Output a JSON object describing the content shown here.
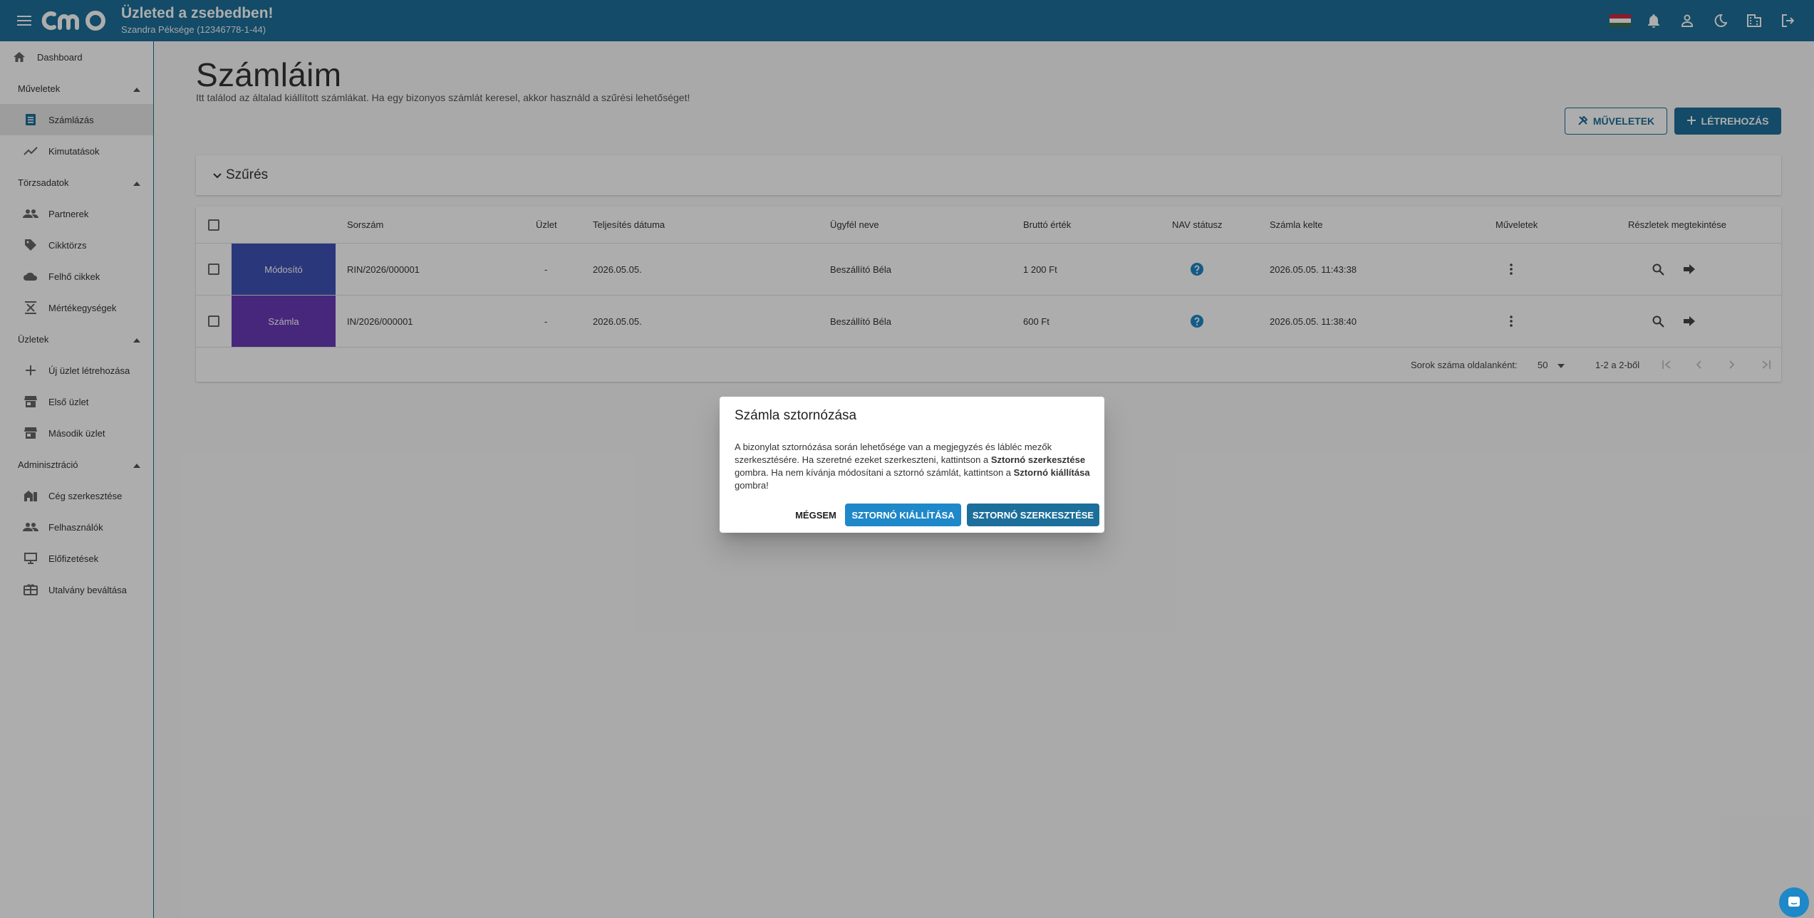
{
  "header": {
    "logo": "cmo",
    "title": "Üzleted a zsebedben!",
    "subtitle": "Szandra Péksége (12346778-1-44)",
    "flag_colors": [
      "#cd2a3e",
      "#ffffff",
      "#436f4d"
    ]
  },
  "sidebar": {
    "dashboard": "Dashboard",
    "sections": [
      {
        "label": "Műveletek",
        "items": [
          "Számlázás",
          "Kimutatások"
        ]
      },
      {
        "label": "Törzsadatok",
        "items": [
          "Partnerek",
          "Cikktörzs",
          "Felhő cikkek",
          "Mértékegységek"
        ]
      },
      {
        "label": "Üzletek",
        "items": [
          "Új üzlet létrehozása",
          "Első üzlet",
          "Második üzlet"
        ]
      },
      {
        "label": "Adminisztráció",
        "items": [
          "Cég szerkesztése",
          "Felhasználók",
          "Előfizetések",
          "Utalvány beváltása"
        ]
      }
    ]
  },
  "page": {
    "title": "Számláim",
    "description": "Itt találod az általad kiállított számlákat. Ha egy bizonyos számlát keresel, akkor használd a szűrési lehetőséget!",
    "actions_button": "MŰVELETEK",
    "create_button": "LÉTREHOZÁS",
    "filter_label": "Szűrés"
  },
  "table": {
    "columns": [
      "Sorszám",
      "Üzlet",
      "Teljesítés dátuma",
      "Ügyfél neve",
      "Bruttó érték",
      "NAV státusz",
      "Számla kelte",
      "Műveletek",
      "Részletek megtekintése"
    ],
    "rows": [
      {
        "type": "Módosító",
        "type_color": "#3f51b5",
        "number": "RIN/2026/000001",
        "shop": "-",
        "date": "2026.05.05.",
        "client": "Beszállító Béla",
        "gross": "1 200 Ft",
        "issued": "2026.05.05. 11:43:38"
      },
      {
        "type": "Számla",
        "type_color": "#673ab7",
        "number": "IN/2026/000001",
        "shop": "-",
        "date": "2026.05.05.",
        "client": "Beszállító Béla",
        "gross": "600 Ft",
        "issued": "2026.05.05. 11:38:40"
      }
    ],
    "footer": {
      "rows_per_page_label": "Sorok száma oldalanként:",
      "rows_per_page": "50",
      "range": "1-2 a 2-ből"
    }
  },
  "dialog": {
    "title": "Számla sztornózása",
    "text_1": "A bizonylat sztornózása során lehetősége van a megjegyzés és lábléc mezők szerkesztésére. Ha szeretné ezeket szerkeszteni, kattintson a ",
    "bold_1": "Sztornó szerkesztése",
    "text_2": " gombra. Ha nem kívánja módosítani a sztornó számlát, kattintson a ",
    "bold_2": "Sztornó kiállítása",
    "text_3": " gombra!",
    "cancel": "MÉGSEM",
    "issue": "SZTORNÓ KIÁLLÍTÁSA",
    "edit": "SZTORNÓ SZERKESZTÉSE"
  }
}
